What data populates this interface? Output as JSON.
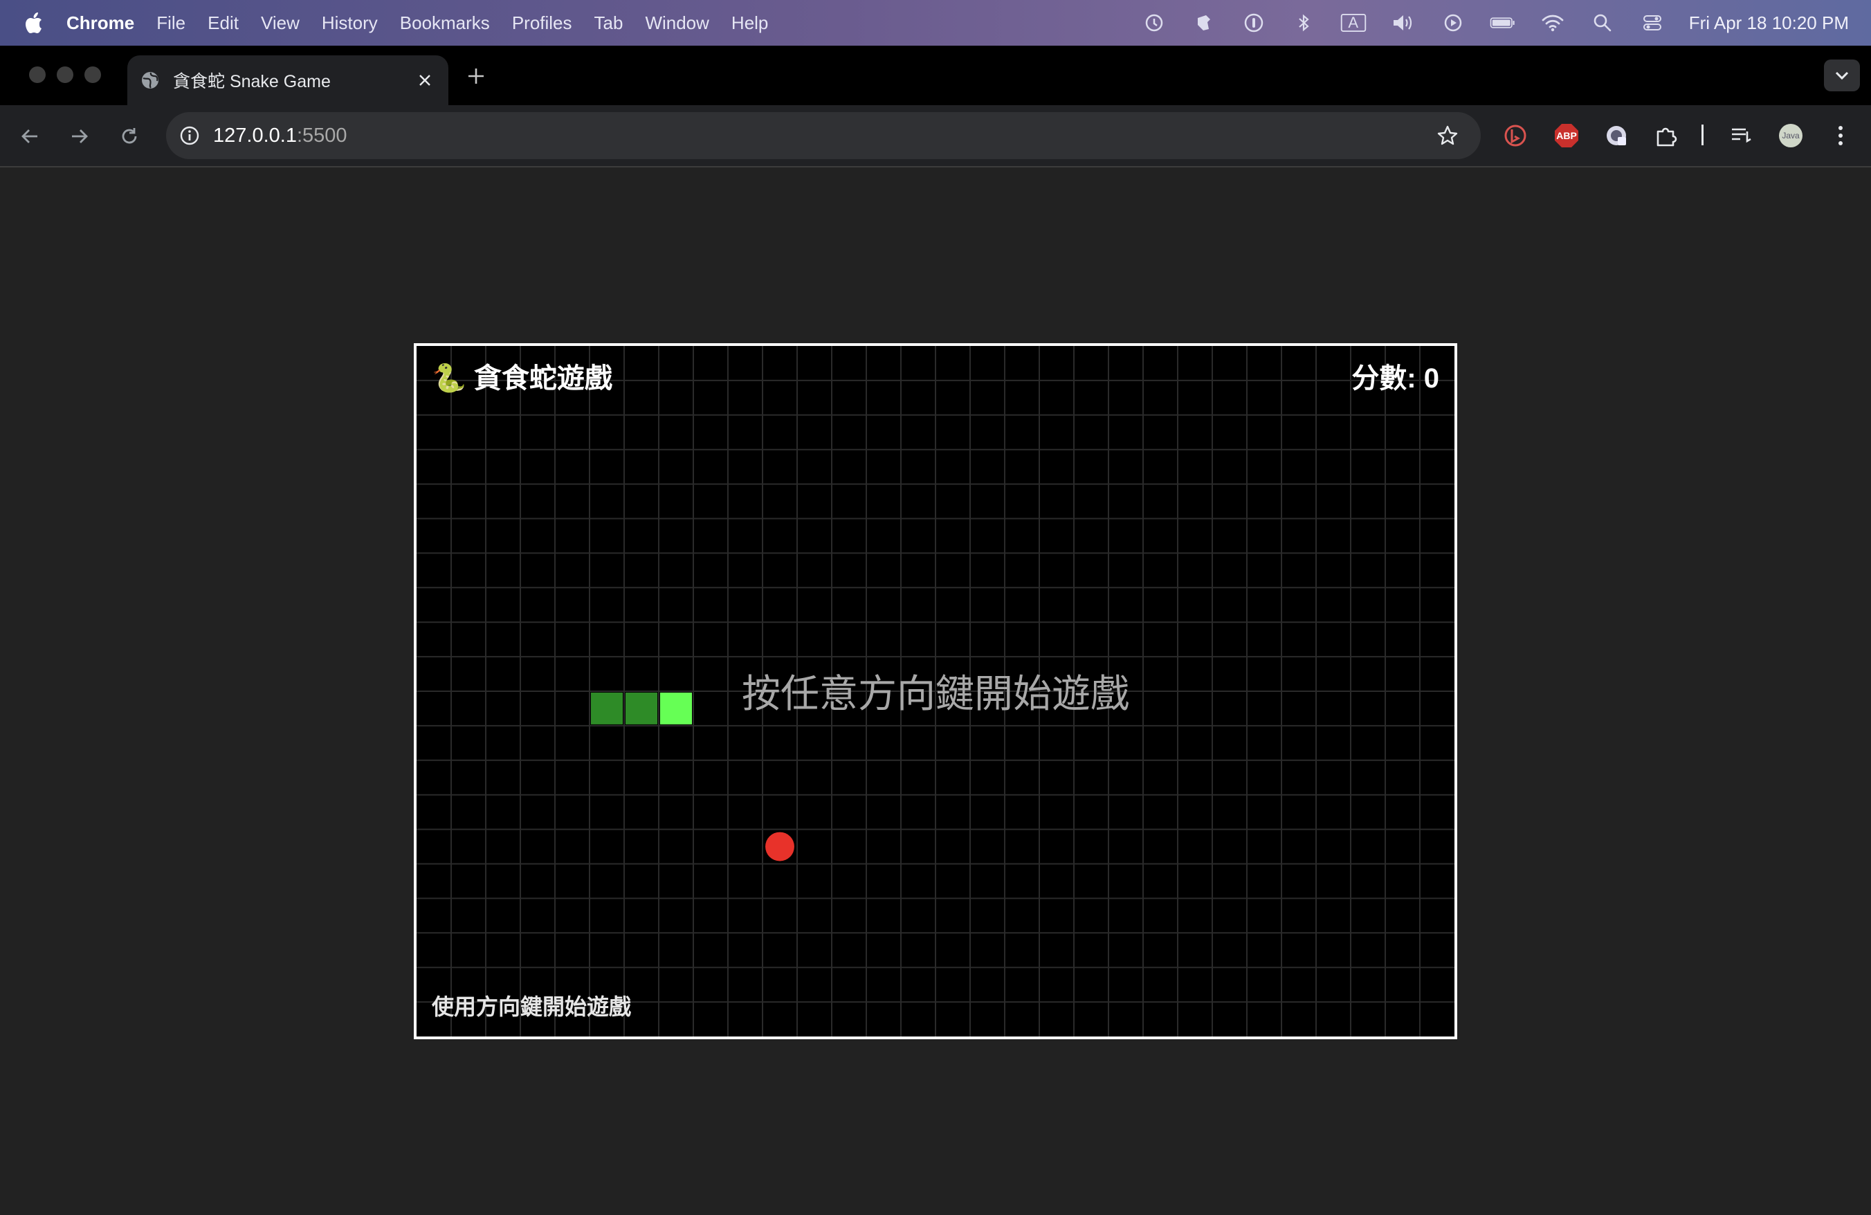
{
  "menubar": {
    "app_name": "Chrome",
    "items": [
      "File",
      "Edit",
      "View",
      "History",
      "Bookmarks",
      "Profiles",
      "Tab",
      "Window",
      "Help"
    ],
    "clock": "Fri Apr 18  10:20 PM",
    "status_icons": [
      "time-machine-icon",
      "tweak-icon",
      "password-icon",
      "bluetooth-icon",
      "input-source-icon",
      "volume-icon",
      "play-icon",
      "battery-icon",
      "wifi-icon",
      "spotlight-icon",
      "control-center-icon"
    ],
    "input_source_glyph": "A"
  },
  "browser": {
    "tab_title": "貪食蛇 Snake Game",
    "url_host": "127.0.0.1",
    "url_port": ":5500",
    "extensions": [
      "bing-icon",
      "adblock-icon",
      "privacy-icon",
      "extensions-icon",
      "reading-list-icon",
      "profile-avatar-icon",
      "more-menu-icon"
    ],
    "adblock_label": "ABP",
    "profile_label": "Java"
  },
  "game": {
    "title": "🐍 貪食蛇遊戲",
    "score_label": "分數: 0",
    "score": 0,
    "start_prompt": "按任意方向鍵開始遊戲",
    "hint": "使用方向鍵開始遊戲",
    "grid": {
      "cols": 30,
      "rows": 20
    },
    "snake": [
      {
        "col": 5,
        "row": 10,
        "part": "body"
      },
      {
        "col": 6,
        "row": 10,
        "part": "body"
      },
      {
        "col": 7,
        "row": 10,
        "part": "head"
      }
    ],
    "food": {
      "col": 10,
      "row": 14
    },
    "colors": {
      "background": "#000000",
      "grid_line": "#2a2a2a",
      "snake_body": "#2e8b27",
      "snake_head": "#66ff55",
      "food": "#e8322a",
      "border": "#ffffff"
    }
  }
}
